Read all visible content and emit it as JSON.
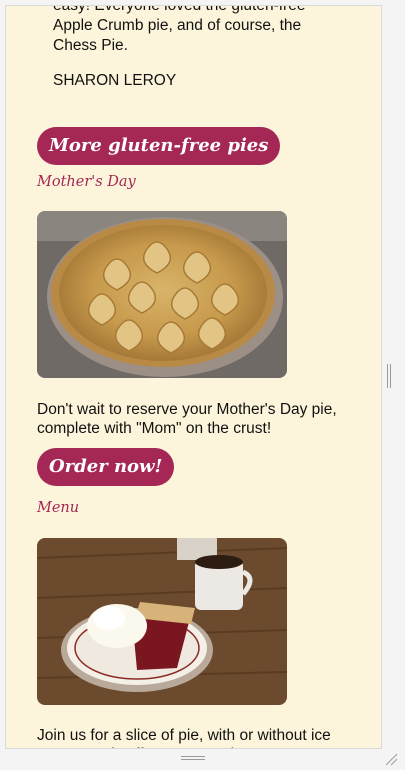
{
  "testimonial": {
    "text": "easy! Everyone loved the gluten-free Apple Crumb pie, and of course, the Chess Pie.",
    "author": "SHARON LEROY"
  },
  "gluten_free_button": {
    "label": "More gluten-free pies"
  },
  "mothers_day_link": {
    "label": "Mother's Day"
  },
  "mothers_day_paragraph": "Don't wait to reserve your Mother's Day pie, complete with \"Mom\" on the crust!",
  "order_button": {
    "label": "Order now!"
  },
  "menu_link": {
    "label": "Menu"
  },
  "menu_paragraph": "Join us for a slice of pie, with or without ice cream, and coffee at our Main Street location.",
  "colors": {
    "page_background": "#fdf5db",
    "accent": "#a52755",
    "text": "#111111"
  }
}
